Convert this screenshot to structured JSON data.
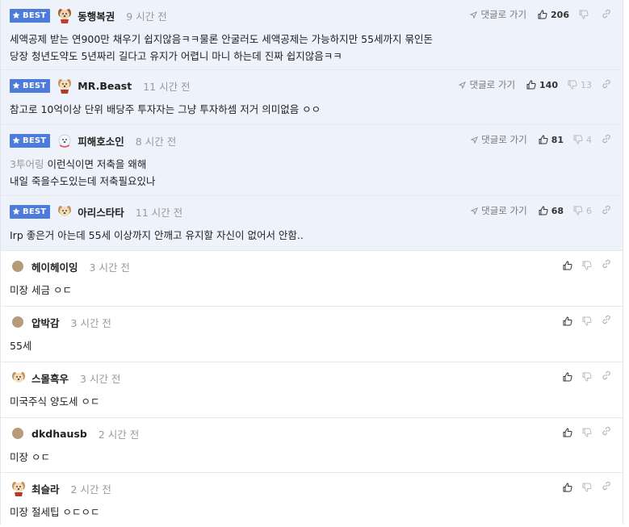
{
  "best_label": "BEST",
  "reply_label": "댓글로 가기",
  "comments": [
    {
      "nick": "동행복권",
      "time": "9 시간 전",
      "up": "206",
      "down": "",
      "lines": [
        "세액공제 받는 연900만 채우기 쉽지않음ㅋㅋ물론 안굴러도 세액공제는 가능하지만 55세까지 묶인돈",
        "당장 청년도약도 5년짜리 길다고 유지가 어렵니 마니 하는데 진짜 쉽지않음ㅋㅋ"
      ]
    },
    {
      "nick": "MR.Beast",
      "time": "11 시간 전",
      "up": "140",
      "down": "13",
      "lines": [
        "참고로 10억이상 단위 배당주 투자자는 그냥 투자하셈 저거 의미없음 ㅇㅇ"
      ]
    },
    {
      "nick": "피해호소인",
      "time": "8 시간 전",
      "up": "81",
      "down": "4",
      "quote": "3투어링",
      "lines": [
        "이런식이면 저축을 왜해",
        "내일 죽을수도있는데 저축필요있나"
      ]
    },
    {
      "nick": "아리스타타",
      "time": "11 시간 전",
      "up": "68",
      "down": "6",
      "lines": [
        "Irp 좋은거 아는데 55세 이상까지 안깨고 유지할 자신이 없어서 안함.."
      ]
    },
    {
      "nick": "헤이헤이잉",
      "time": "3 시간 전",
      "text": "미장 세금 ㅇㄷ"
    },
    {
      "nick": "압박감",
      "time": "3 시간 전",
      "text": "55세"
    },
    {
      "nick": "스몰흑우",
      "time": "3 시간 전",
      "text": "미국주식 양도세 ㅇㄷ"
    },
    {
      "nick": "dkdhausb",
      "time": "2 시간 전",
      "text": "미장 ㅇㄷ"
    },
    {
      "nick": "최슬라",
      "time": "2 시간 전",
      "text": "미장 절세팁 ㅇㄷㅇㄷ"
    }
  ]
}
